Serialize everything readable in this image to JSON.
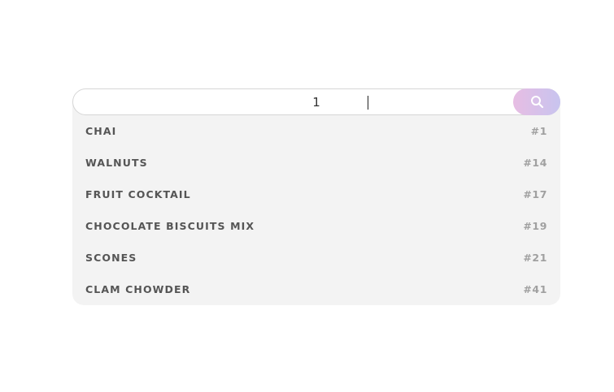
{
  "search": {
    "value": "1",
    "button_icon": "search-icon",
    "button_gradient": [
      "#e7bde3",
      "#c8c4ef"
    ]
  },
  "results": [
    {
      "name": "CHAI",
      "number": "#1"
    },
    {
      "name": "WALNUTS",
      "number": "#14"
    },
    {
      "name": "FRUIT COCKTAIL",
      "number": "#17"
    },
    {
      "name": "CHOCOLATE BISCUITS MIX",
      "number": "#19"
    },
    {
      "name": "SCONES",
      "number": "#21"
    },
    {
      "name": "CLAM CHOWDER",
      "number": "#41"
    }
  ]
}
